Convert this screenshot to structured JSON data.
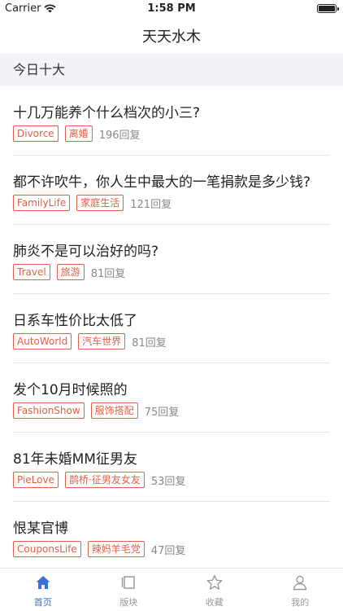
{
  "status_bar": {
    "carrier": "Carrier",
    "time": "1:58 PM"
  },
  "nav": {
    "title": "天天水木"
  },
  "section": {
    "title": "今日十大"
  },
  "threads": [
    {
      "title": "十几万能养个什么档次的小三?",
      "board_en": "Divorce",
      "board_cn": "离婚",
      "replies": "196回复"
    },
    {
      "title": "都不许吹牛，你人生中最大的一笔捐款是多少钱?",
      "board_en": "FamilyLife",
      "board_cn": "家庭生活",
      "replies": "121回复"
    },
    {
      "title": "肺炎不是可以治好的吗?",
      "board_en": "Travel",
      "board_cn": "旅游",
      "replies": "81回复"
    },
    {
      "title": "日系车性价比太低了",
      "board_en": "AutoWorld",
      "board_cn": "汽车世界",
      "replies": "81回复"
    },
    {
      "title": "发个10月时候照的",
      "board_en": "FashionShow",
      "board_cn": "服饰搭配",
      "replies": "75回复"
    },
    {
      "title": "81年未婚MM征男友",
      "board_en": "PieLove",
      "board_cn": "鹊桥·征男友女友",
      "replies": "53回复"
    },
    {
      "title": "恨某官博",
      "board_en": "CouponsLife",
      "board_cn": "辣妈羊毛党",
      "replies": "47回复"
    }
  ],
  "tab_bar": {
    "tabs": [
      {
        "label": "首页",
        "icon": "home-icon",
        "active": true
      },
      {
        "label": "版块",
        "icon": "board-icon",
        "active": false
      },
      {
        "label": "收藏",
        "icon": "star-icon",
        "active": false
      },
      {
        "label": "我的",
        "icon": "person-icon",
        "active": false
      }
    ]
  },
  "colors": {
    "accent": "#3a6fd8",
    "tag": "#e0604a",
    "section_bg": "#f2f2f7"
  }
}
